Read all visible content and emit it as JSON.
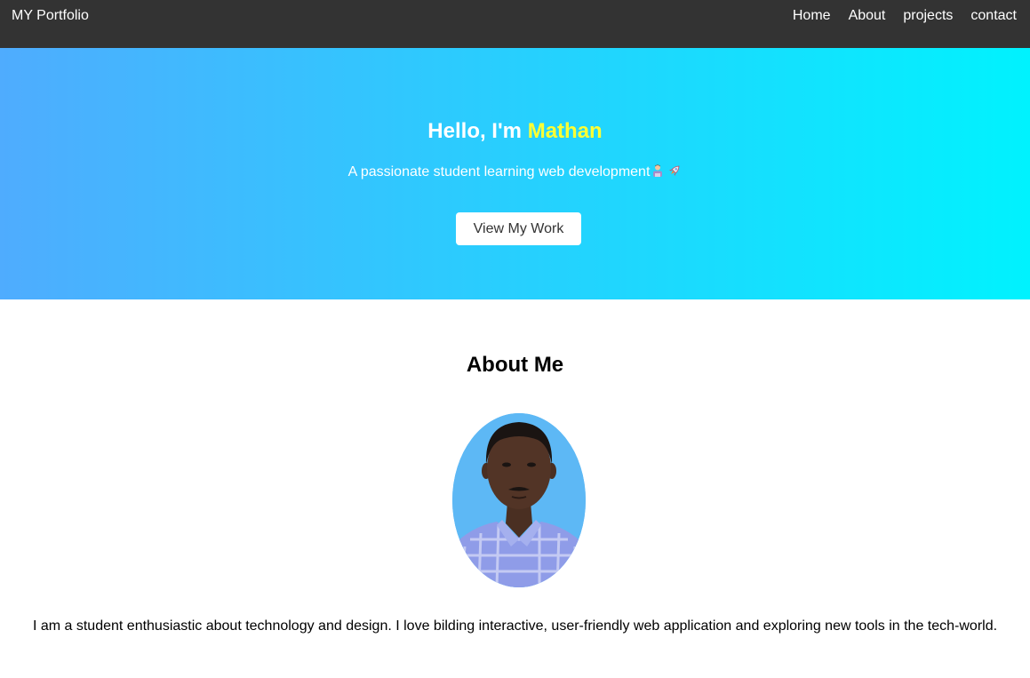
{
  "navbar": {
    "brand": "MY Portfolio",
    "links": [
      "Home",
      "About",
      "projects",
      "contact"
    ],
    "background": "#333333"
  },
  "hero": {
    "greeting": "Hello, I'm ",
    "name": "Mathan",
    "subtitle": "A passionate student learning web development",
    "subtitle_icons": [
      "boy-emoji-icon",
      "rocket-emoji-icon"
    ],
    "cta_label": "View My Work",
    "gradient_start": "#4facfe",
    "gradient_end": "#00f2fe",
    "name_color": "#ffff33"
  },
  "about": {
    "title": "About Me",
    "text": "I am a student enthusiastic about technology and design. I love bilding interactive, user-friendly web application and exploring new tools in the tech-world."
  }
}
